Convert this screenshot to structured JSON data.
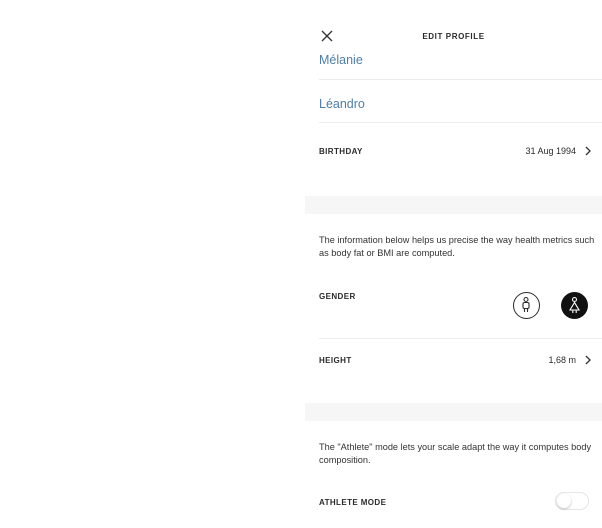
{
  "header": {
    "title": "EDIT PROFILE",
    "close_icon": "close-icon"
  },
  "profile": {
    "first_name": "Mélanie",
    "last_name": "Léandro",
    "birthday_label": "BIRTHDAY",
    "birthday_value": "31 Aug 1994"
  },
  "health_info": {
    "description": "The information below helps us precise the way health metrics such as body fat or BMI are computed.",
    "gender_label": "GENDER",
    "gender_options": [
      "male",
      "female"
    ],
    "gender_selected": "female",
    "height_label": "HEIGHT",
    "height_value": "1,68 m"
  },
  "athlete": {
    "description": "The \"Athlete\" mode lets your scale adapt the way it computes body composition.",
    "label": "ATHLETE MODE",
    "enabled": false
  },
  "colors": {
    "accent_text": "#4f7ea6",
    "selected_gender": "#111111",
    "band": "#f6f6f6"
  }
}
